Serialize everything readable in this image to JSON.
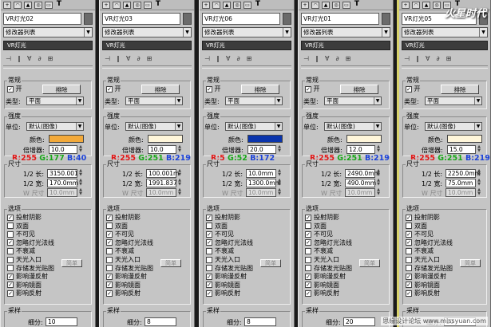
{
  "watermark": "火星时代",
  "bottom_watermark": "思缘设计论坛 www.missyuan.com",
  "labels": {
    "modifier_list": "修改器列表",
    "stack_item": "VR灯光",
    "general": "常规",
    "on": "开",
    "exclude": "排除",
    "type": "类型:",
    "intensity": "强度",
    "units": "单位:",
    "color": "颜色:",
    "multiplier": "倍增器:",
    "size": "尺寸",
    "half_length": "1/2 长:",
    "half_width": "1/2 宽:",
    "w_size": "W 尺寸",
    "options": "选项",
    "cast_shadows": "投射阴影",
    "double_sided": "双面",
    "invisible": "不可见",
    "ignore_normals": "忽略灯光法线",
    "no_decay": "不衰减",
    "skylight_portal": "天光入口",
    "simple": "简单",
    "store_irradiance": "存储发光贴图",
    "affect_diffuse": "影响漫反射",
    "affect_specular": "影响镜面",
    "affect_reflections": "影响反射",
    "sampling": "采样",
    "subdivs": "细分:"
  },
  "panels": [
    {
      "name": "VR灯光02",
      "type_value": "平面",
      "units_value": "默认(图像)",
      "color_hex": "#f2a93a",
      "multiplier": "10.0",
      "rgb_r": "R:255",
      "rgb_g": "G:177",
      "rgb_b": "B:40",
      "half_length": "3150.001",
      "half_width": "170.0mm",
      "w_size": "10.0mm",
      "checks": [
        true,
        false,
        false,
        true,
        false,
        false,
        false,
        true,
        true,
        true
      ],
      "subdivs": "10"
    },
    {
      "name": "VR灯光03",
      "type_value": "平面",
      "units_value": "默认(图像)",
      "color_hex": "#fff6da",
      "multiplier": "10.0",
      "rgb_r": "R:255",
      "rgb_g": "G:251",
      "rgb_b": "B:219",
      "half_length": "100.001m",
      "half_width": "1991.837",
      "w_size": "10.0mm",
      "checks": [
        true,
        false,
        true,
        true,
        false,
        false,
        false,
        true,
        true,
        true
      ],
      "subdivs": "8"
    },
    {
      "name": "VR灯光06",
      "type_value": "平面",
      "units_value": "默认(图像)",
      "color_hex": "#0a34ac",
      "multiplier": "20.0",
      "rgb_r": "R:5",
      "rgb_g": "G:52",
      "rgb_b": "B:172",
      "half_length": "10.0mm",
      "half_width": "1300.0mm",
      "w_size": "10.0mm",
      "checks": [
        true,
        false,
        true,
        true,
        false,
        false,
        false,
        true,
        true,
        true
      ],
      "subdivs": "8"
    },
    {
      "name": "VR灯光01",
      "type_value": "平面",
      "units_value": "默认(图像)",
      "color_hex": "#fff6da",
      "multiplier": "12.0",
      "rgb_r": "R:255",
      "rgb_g": "G:251",
      "rgb_b": "B:219",
      "half_length": "2490.0mm",
      "half_width": "490.0mm",
      "w_size": "10.0mm",
      "checks": [
        true,
        false,
        true,
        true,
        false,
        false,
        false,
        true,
        true,
        true
      ],
      "subdivs": "20"
    },
    {
      "name": "VR灯光05",
      "type_value": "平面",
      "units_value": "默认(图像)",
      "color_hex": "#fff6da",
      "multiplier": "15.0",
      "rgb_r": "R:255",
      "rgb_g": "G:251",
      "rgb_b": "B:219",
      "half_length": "2250.0mm",
      "half_width": "75.0mm",
      "w_size": "10.0mm",
      "checks": [
        true,
        false,
        true,
        true,
        false,
        false,
        false,
        true,
        true,
        true
      ],
      "subdivs": "20"
    }
  ]
}
